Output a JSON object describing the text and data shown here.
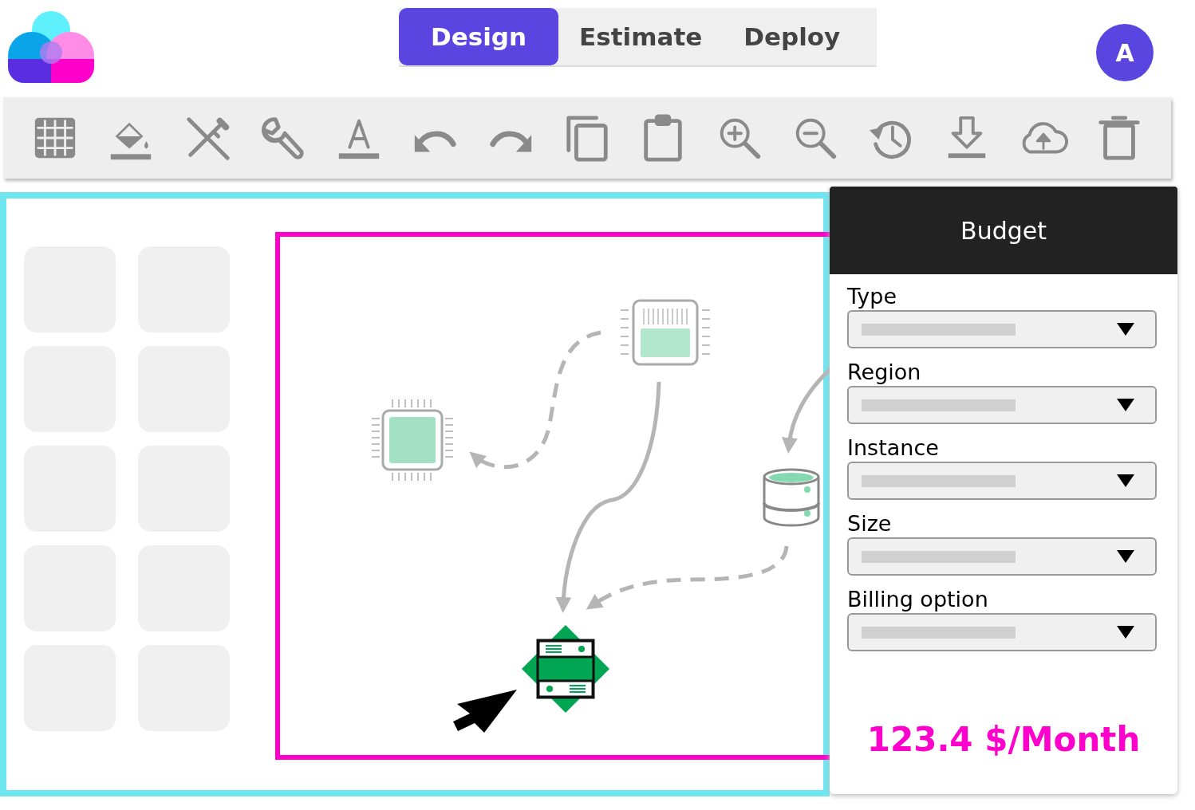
{
  "header": {
    "tabs": [
      {
        "label": "Design",
        "selected": true
      },
      {
        "label": "Estimate",
        "selected": false
      },
      {
        "label": "Deploy",
        "selected": false
      }
    ],
    "avatar": {
      "initial": "A"
    }
  },
  "budget_panel": {
    "title": "Budget",
    "fields": [
      {
        "label": "Type"
      },
      {
        "label": "Region"
      },
      {
        "label": "Instance"
      },
      {
        "label": "Size"
      },
      {
        "label": "Billing option"
      }
    ],
    "total": "123.4 $/Month"
  }
}
